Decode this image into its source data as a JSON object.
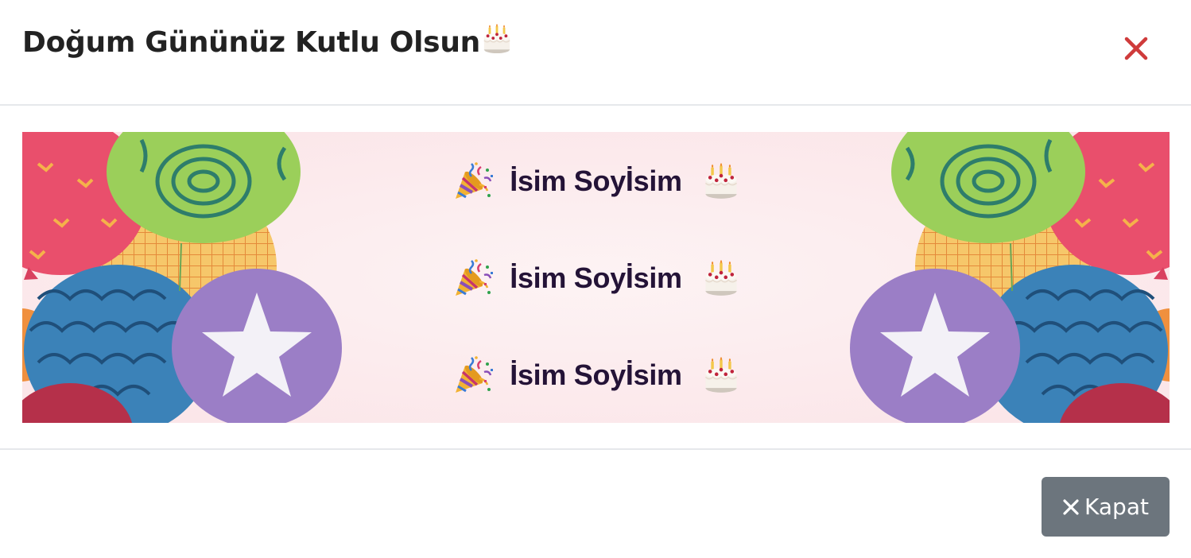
{
  "modal": {
    "title": "Doğum Gününüz Kutlu Olsun",
    "title_emoji": "cake-icon",
    "close_icon": "close-icon",
    "close_color": "#cf3b3b"
  },
  "banner": {
    "background_color": "#fcecee",
    "names": [
      {
        "name": "İsim Soyİsim",
        "left_icon": "party-popper-icon",
        "right_icon": "birthday-cake-icon"
      },
      {
        "name": "İsim Soyİsim",
        "left_icon": "party-popper-icon",
        "right_icon": "birthday-cake-icon"
      },
      {
        "name": "İsim Soyİsim",
        "left_icon": "party-popper-icon",
        "right_icon": "birthday-cake-icon"
      }
    ]
  },
  "footer": {
    "close_button_label": "Kapat",
    "close_button_icon": "close-icon",
    "close_button_color": "#6c757d"
  }
}
